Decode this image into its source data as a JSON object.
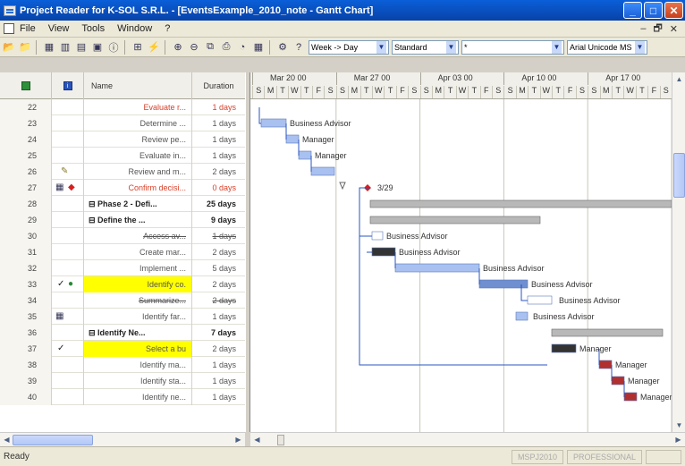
{
  "window": {
    "title": "Project Reader for K-SOL S.R.L. - [EventsExample_2010_note - Gantt Chart]"
  },
  "menu": [
    "File",
    "View",
    "Tools",
    "Window",
    "?"
  ],
  "toolbar": {
    "timescale": "Week -> Day",
    "view": "Standard",
    "filter": "*",
    "font": "Arial Unicode MS"
  },
  "grid": {
    "headers": {
      "name": "Name",
      "duration": "Duration"
    },
    "rows": [
      {
        "id": "22",
        "name": "Evaluate r...",
        "duration": "1 days",
        "style": "red",
        "indicators": ""
      },
      {
        "id": "23",
        "name": "Determine ...",
        "duration": "1 days",
        "style": "",
        "indicators": ""
      },
      {
        "id": "24",
        "name": "Review pe...",
        "duration": "1 days",
        "style": "",
        "indicators": ""
      },
      {
        "id": "25",
        "name": "Evaluate in...",
        "duration": "1 days",
        "style": "",
        "indicators": ""
      },
      {
        "id": "26",
        "name": "Review and m...",
        "duration": "2 days",
        "style": "",
        "indicators": "note"
      },
      {
        "id": "27",
        "name": "Confirm decisi...",
        "duration": "0 days",
        "style": "red",
        "indicators": "calendar-warning"
      },
      {
        "id": "28",
        "name": "Phase 2 - Defi...",
        "duration": "25 days",
        "style": "summary",
        "indicators": ""
      },
      {
        "id": "29",
        "name": "Define the ...",
        "duration": "9 days",
        "style": "summary",
        "indicators": ""
      },
      {
        "id": "30",
        "name": "Access av...",
        "duration": "1 days",
        "style": "strike",
        "indicators": ""
      },
      {
        "id": "31",
        "name": "Create mar...",
        "duration": "2 days",
        "style": "",
        "indicators": ""
      },
      {
        "id": "32",
        "name": "Implement ...",
        "duration": "5 days",
        "style": "",
        "indicators": ""
      },
      {
        "id": "33",
        "name": "Identify co.",
        "duration": "2 days",
        "style": "hl",
        "indicators": "check-globe"
      },
      {
        "id": "34",
        "name": "Summarize...",
        "duration": "2 days",
        "style": "strike",
        "indicators": ""
      },
      {
        "id": "35",
        "name": "Identify far...",
        "duration": "1 days",
        "style": "",
        "indicators": "calendar"
      },
      {
        "id": "36",
        "name": "Identify Ne...",
        "duration": "7 days",
        "style": "summary",
        "indicators": ""
      },
      {
        "id": "37",
        "name": "Select a bu",
        "duration": "2 days",
        "style": "hl",
        "indicators": "check"
      },
      {
        "id": "38",
        "name": "Identify ma...",
        "duration": "1 days",
        "style": "",
        "indicators": ""
      },
      {
        "id": "39",
        "name": "Identify sta...",
        "duration": "1 days",
        "style": "",
        "indicators": ""
      },
      {
        "id": "40",
        "name": "Identify ne...",
        "duration": "1 days",
        "style": "",
        "indicators": ""
      }
    ]
  },
  "gantt": {
    "weeks": [
      "Mar 20 00",
      "Mar 27 00",
      "Apr 03 00",
      "Apr 10 00",
      "Apr 17 00"
    ],
    "days": [
      "S",
      "M",
      "T",
      "W",
      "T",
      "F",
      "S"
    ],
    "labels": {
      "business_advisor": "Business Advisor",
      "manager": "Manager",
      "milestone": "3/29"
    }
  },
  "status": {
    "ready": "Ready",
    "version": "MSPJ2010",
    "edition": "PROFESSIONAL"
  }
}
